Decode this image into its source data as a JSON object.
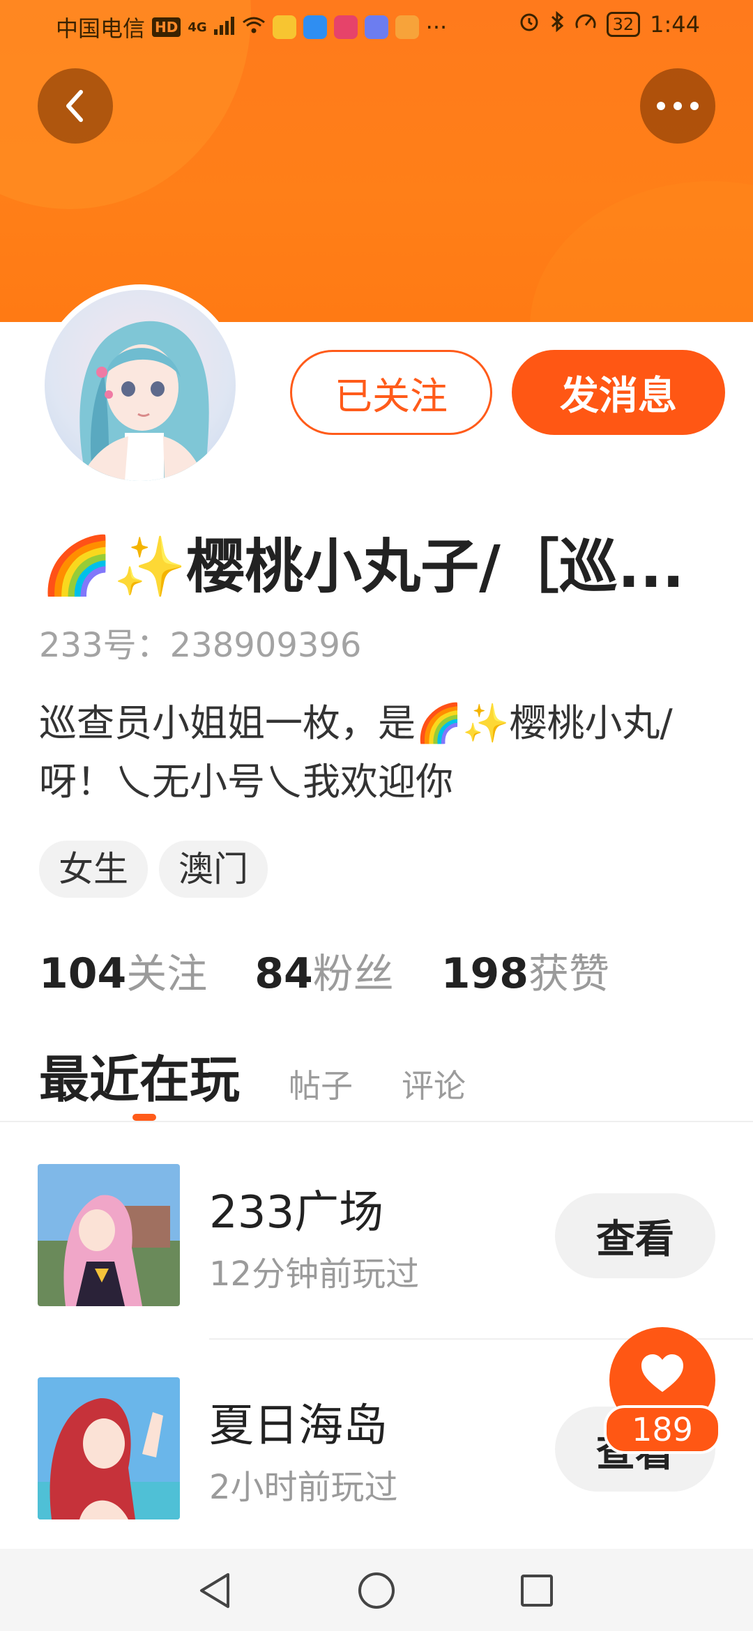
{
  "status_bar": {
    "carrier": "中国电信",
    "hd_badge": "HD",
    "network": "4G",
    "more": "···",
    "battery": "32",
    "time": "1:44"
  },
  "profile": {
    "followed_label": "已关注",
    "message_label": "发消息",
    "name": "🌈✨樱桃小丸子/［巡...",
    "uid": "233号：238909396",
    "bio": "巡查员小姐姐一枚，是🌈✨樱桃小丸/呀！乀无小号乀我欢迎你",
    "tags": [
      "女生",
      "澳门"
    ],
    "stats": [
      {
        "num": "104",
        "label": "关注"
      },
      {
        "num": "84",
        "label": "粉丝"
      },
      {
        "num": "198",
        "label": "获赞"
      }
    ]
  },
  "tabs": {
    "active": "最近在玩",
    "others": [
      "帖子",
      "评论"
    ]
  },
  "games": [
    {
      "name": "233广场",
      "time": "12分钟前玩过",
      "button": "查看"
    },
    {
      "name": "夏日海岛",
      "time": "2小时前玩过",
      "button": "查看"
    }
  ],
  "like_float": {
    "count": "189"
  },
  "colors": {
    "accent": "#ff5714",
    "header": "#ff7a1c"
  },
  "icons": [
    "back-arrow-icon",
    "more-dots-icon",
    "heart-icon",
    "nav-back-icon",
    "nav-home-icon",
    "nav-recents-icon"
  ]
}
